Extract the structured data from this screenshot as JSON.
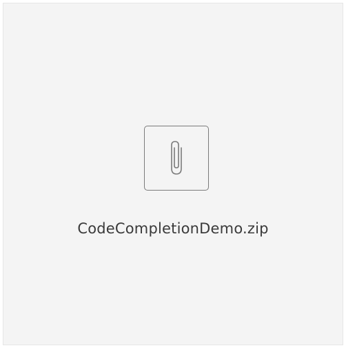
{
  "attachment": {
    "file_name": "CodeCompletionDemo.zip",
    "icon": "paperclip-icon",
    "colors": {
      "card_background": "#f4f4f4",
      "card_border": "#e6e6e6",
      "icon_stroke": "#7a7a7a",
      "text": "#3a3a3a"
    }
  }
}
